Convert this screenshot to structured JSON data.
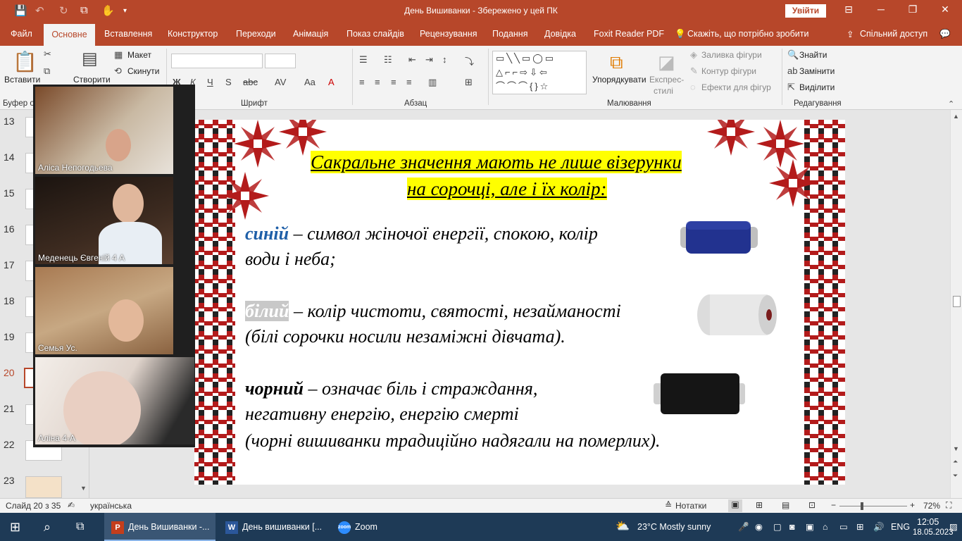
{
  "window": {
    "title": "День Вишиванки  -  Збережено у цей ПК",
    "signin": "Увійти",
    "min": "─",
    "restore": "❐",
    "close": "✕"
  },
  "tabs": [
    {
      "label": "Файл"
    },
    {
      "label": "Основне"
    },
    {
      "label": "Вставлення"
    },
    {
      "label": "Конструктор"
    },
    {
      "label": "Переходи"
    },
    {
      "label": "Анімація"
    },
    {
      "label": "Показ слайдів"
    },
    {
      "label": "Рецензування"
    },
    {
      "label": "Подання"
    },
    {
      "label": "Довідка"
    },
    {
      "label": "Foxit Reader PDF"
    },
    {
      "label": "Скажіть, що потрібно зробити"
    },
    {
      "label": "Спільний доступ"
    }
  ],
  "ribbon": {
    "paste": "Вставити",
    "clipboard_group": "Буфер о",
    "create": "Створити",
    "layout": "Макет",
    "reset": "Скинути",
    "font_group": "Шрифт",
    "para_group": "Абзац",
    "draw_group": "Малювання",
    "arrange": "Упорядкувати",
    "quick_styles_1": "Експрес-",
    "quick_styles_2": "стилі",
    "shape_fill": "Заливка фігури",
    "shape_outline": "Контур фігури",
    "shape_effects": "Ефекти для фігур",
    "find": "Знайти",
    "replace": "Замінити",
    "select": "Виділити",
    "edit_group": "Редагування"
  },
  "thumbnails": [
    {
      "num": "13"
    },
    {
      "num": "14"
    },
    {
      "num": "15"
    },
    {
      "num": "16"
    },
    {
      "num": "17"
    },
    {
      "num": "18"
    },
    {
      "num": "19"
    },
    {
      "num": "20"
    },
    {
      "num": "21"
    },
    {
      "num": "22"
    },
    {
      "num": "23"
    }
  ],
  "participants": [
    {
      "name": "Аліса Непогодьева"
    },
    {
      "name": "Меденець Євгеній 4 А"
    },
    {
      "name": "Семья Ус."
    },
    {
      "name": "Аліна 4-А"
    }
  ],
  "slide": {
    "title_line1": "Сакральне значення мають не лише візерунки",
    "title_line2": "на сорочці, але і їх колір:",
    "blue_kw": "синій",
    "blue_rest": " – символ жіночої енергії, спокою, колір",
    "blue_line2": " води і неба;",
    "white_kw": "білий",
    "white_rest": " – колір чистоти, святості, незайманості",
    "white_line2": "(білі сорочки носили незаміжні дівчата).",
    "black_kw": "чорний",
    "black_rest": " – означає біль і страждання,",
    "black_line2": "негативну енергію, енергію смерті",
    "black_line3": "(чорні вишиванки традиційно надягали на померлих)."
  },
  "status": {
    "slide_info": "Слайд 20 з 35",
    "language": "українська",
    "notes": "Нотатки",
    "zoom": "72%"
  },
  "taskbar": {
    "app1": "День Вишиванки -...",
    "app2": "День вишиванки [...",
    "app3": "Zoom",
    "weather": "23°C  Mostly sunny",
    "lang": "ENG",
    "time": "12:05",
    "date": "18.05.2023"
  },
  "colors": {
    "accent": "#b7472a",
    "blue_kw": "#1f5fa8",
    "taskbar": "#1e3a56"
  }
}
